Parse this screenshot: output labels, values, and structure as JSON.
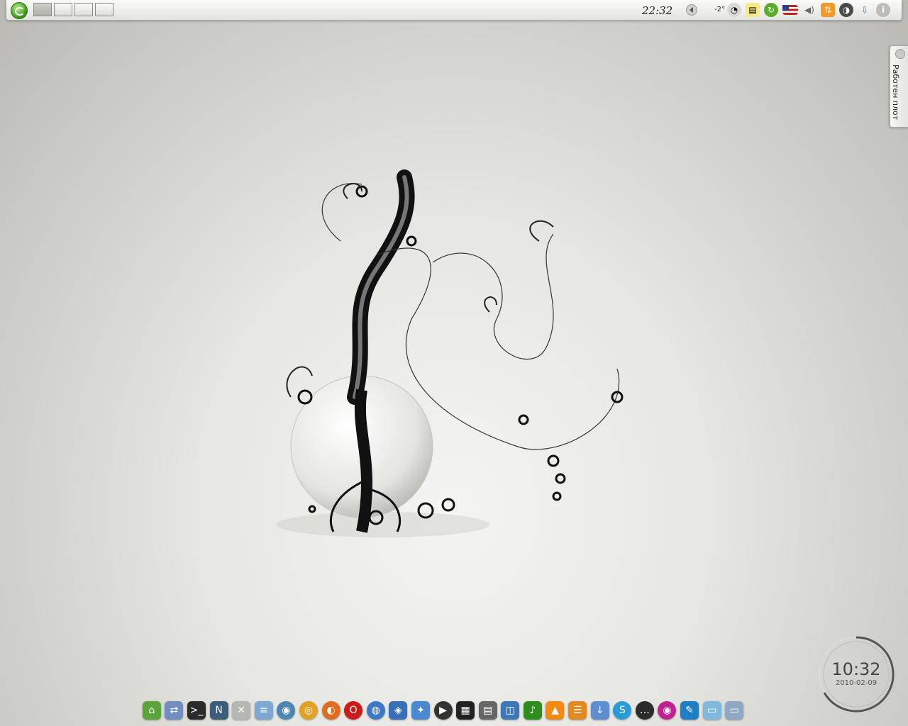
{
  "top_panel": {
    "clock": "22:32",
    "weather_temp": "-2°",
    "pager_desktops": 4,
    "tray_icons": [
      "weather-icon",
      "notes-icon",
      "update-icon",
      "keyboard-layout-us-icon",
      "volume-icon",
      "network-icon",
      "klipper-icon",
      "download-icon",
      "info-icon"
    ]
  },
  "desktop_tab": {
    "label": "Работен плот"
  },
  "clock_widget": {
    "time": "10:32",
    "date": "2010-02-09"
  },
  "dock": {
    "items": [
      {
        "name": "home-folder-icon",
        "color": "#5aa43a",
        "glyph": "⌂"
      },
      {
        "name": "network-places-icon",
        "color": "#6e8fbf",
        "glyph": "⇄"
      },
      {
        "name": "terminal-icon",
        "color": "#2b2b2b",
        "glyph": ">_"
      },
      {
        "name": "nvidia-settings-icon",
        "color": "#3c5d7a",
        "glyph": "N"
      },
      {
        "name": "system-settings-icon",
        "color": "#b7b7b2",
        "glyph": "✕"
      },
      {
        "name": "text-editor-icon",
        "color": "#7fa7d4",
        "glyph": "≡"
      },
      {
        "name": "browser-globe-icon",
        "color": "#4c86b3",
        "glyph": "◉"
      },
      {
        "name": "chrome-icon",
        "color": "#e1a122",
        "glyph": "◎"
      },
      {
        "name": "firefox-icon",
        "color": "#e06d1f",
        "glyph": "◐"
      },
      {
        "name": "opera-icon",
        "color": "#cc1b1b",
        "glyph": "O"
      },
      {
        "name": "konqueror-icon",
        "color": "#3c7ac9",
        "glyph": "◍"
      },
      {
        "name": "kget-icon",
        "color": "#3870b7",
        "glyph": "◈"
      },
      {
        "name": "amarok-wolf-icon",
        "color": "#4a89d2",
        "glyph": "✦"
      },
      {
        "name": "media-player-icon",
        "color": "#333333",
        "glyph": "▶"
      },
      {
        "name": "video-editor-icon",
        "color": "#222222",
        "glyph": "▦"
      },
      {
        "name": "film-strip-icon",
        "color": "#666666",
        "glyph": "▤"
      },
      {
        "name": "screenshot-icon",
        "color": "#3d78b6",
        "glyph": "◫"
      },
      {
        "name": "music-player-icon",
        "color": "#2f8d1e",
        "glyph": "♪"
      },
      {
        "name": "vlc-icon",
        "color": "#f28a16",
        "glyph": "▲"
      },
      {
        "name": "rss-reader-icon",
        "color": "#e08a20",
        "glyph": "☰"
      },
      {
        "name": "download-manager-icon",
        "color": "#5d8fd0",
        "glyph": "↓"
      },
      {
        "name": "skype-icon",
        "color": "#2a9bd9",
        "glyph": "S"
      },
      {
        "name": "chat-icon",
        "color": "#2b2b2b",
        "glyph": "…"
      },
      {
        "name": "eye-viewer-icon",
        "color": "#c1208e",
        "glyph": "◉"
      },
      {
        "name": "photo-editor-icon",
        "color": "#1f7fc6",
        "glyph": "✎"
      },
      {
        "name": "notes-app-icon",
        "color": "#7fb9dd",
        "glyph": "▭"
      },
      {
        "name": "show-desktop-icon",
        "color": "#8fa8c6",
        "glyph": "▭"
      }
    ]
  }
}
